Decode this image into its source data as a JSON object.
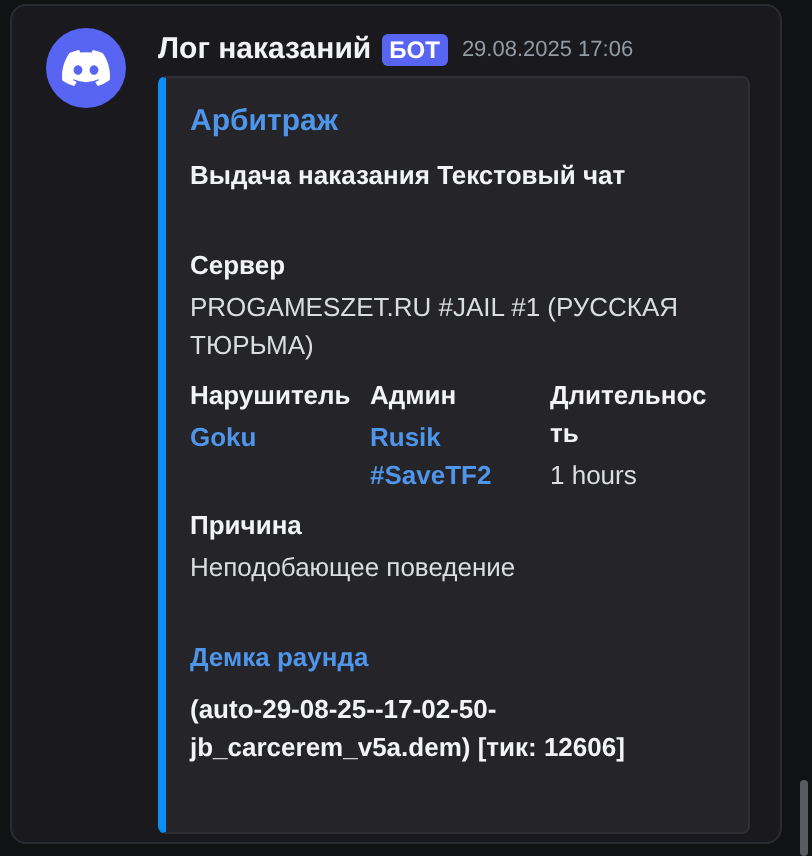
{
  "message": {
    "author": "Лог наказаний",
    "badge": "БОТ",
    "timestamp": "29.08.2025 17:06",
    "embed": {
      "title": "Арбитраж",
      "description": "Выдача наказания Текстовый чат",
      "fields": [
        {
          "name": "Сервер",
          "value": "PROGAMESZET.RU #JAIL #1 (РУССКАЯ ТЮРЬМА)",
          "inline": false,
          "kind": "text"
        },
        {
          "name": "Нарушитель",
          "value": "Goku",
          "inline": true,
          "kind": "mention"
        },
        {
          "name": "Админ",
          "value": "Rusik #SaveTF2",
          "inline": true,
          "kind": "mention"
        },
        {
          "name": "Длительность",
          "value": "1 hours",
          "inline": true,
          "kind": "text"
        },
        {
          "name": "Причина",
          "value": "Неподобающее поведение",
          "inline": false,
          "kind": "text"
        },
        {
          "name": "Демка раунда",
          "value": "(auto-29-08-25--17-02-50-jb_carcerem_v5a.dem) [тик: 12606]",
          "inline": false,
          "kind": "demo"
        }
      ]
    }
  }
}
